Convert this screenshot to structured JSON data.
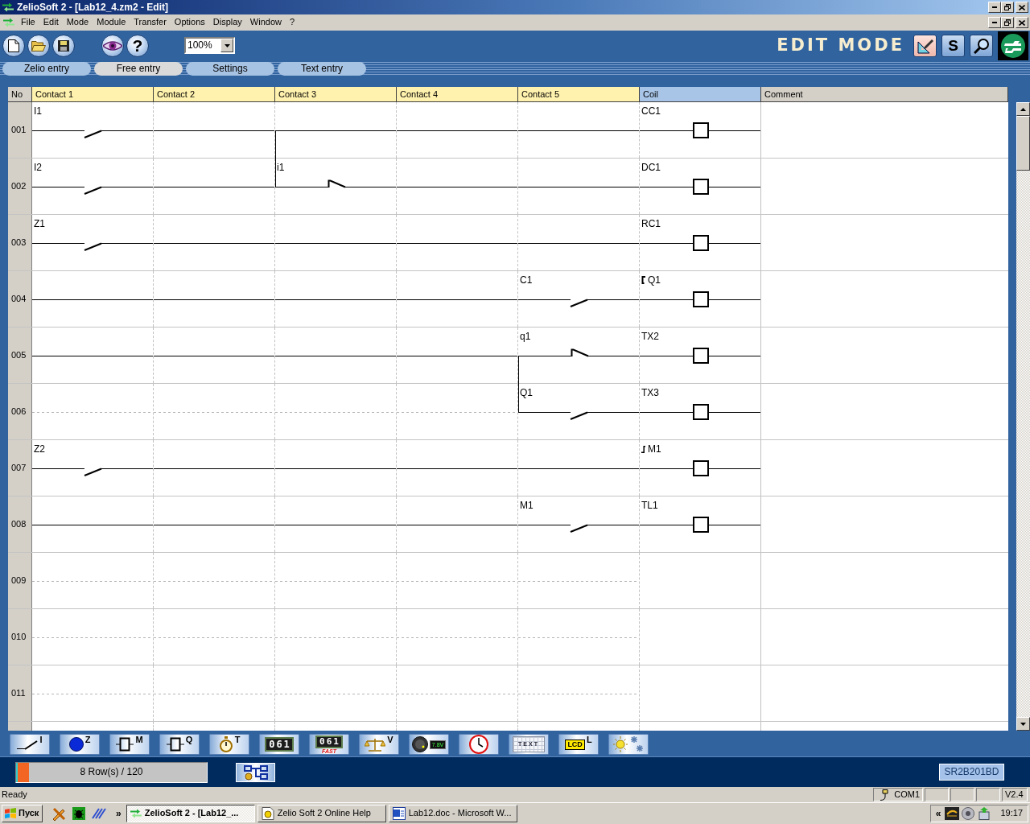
{
  "window": {
    "title": "ZelioSoft 2 - [Lab12_4.zm2 - Edit]"
  },
  "menu": [
    "File",
    "Edit",
    "Mode",
    "Module",
    "Transfer",
    "Options",
    "Display",
    "Window",
    "?"
  ],
  "toolbar": {
    "buttons": [
      {
        "kind": "new"
      },
      {
        "kind": "open"
      },
      {
        "kind": "save"
      },
      {
        "kind": "view"
      },
      {
        "kind": "help",
        "text": "?"
      }
    ],
    "zoom": "100%",
    "mode_label": "EDIT MODE",
    "mode_buttons": [
      {
        "kind": "edit",
        "selected": true
      },
      {
        "kind": "simulation",
        "text": "S",
        "selected": false
      },
      {
        "kind": "monitoring",
        "selected": false
      }
    ]
  },
  "tabs": [
    {
      "label": "Zelio entry",
      "selected": false
    },
    {
      "label": "Free entry",
      "selected": true
    },
    {
      "label": "Settings",
      "selected": false
    },
    {
      "label": "Text entry",
      "selected": false
    }
  ],
  "ladder": {
    "columns": [
      {
        "label": "No",
        "kind": "number"
      },
      {
        "label": "Contact 1",
        "kind": "contact"
      },
      {
        "label": "Contact 2",
        "kind": "contact"
      },
      {
        "label": "Contact 3",
        "kind": "contact"
      },
      {
        "label": "Contact 4",
        "kind": "contact"
      },
      {
        "label": "Contact 5",
        "kind": "contact"
      },
      {
        "label": "Coil",
        "kind": "coil"
      },
      {
        "label": "Comment",
        "kind": "comment"
      }
    ],
    "rows": [
      {
        "number": "001",
        "contacts": [
          {
            "kind": "no_contact",
            "label": "I1",
            "branch_down": false
          },
          {
            "kind": "wire",
            "branch_down": false
          },
          {
            "kind": "wire",
            "branch_down": true
          },
          {
            "kind": "wire",
            "branch_down": false
          },
          {
            "kind": "wire",
            "branch_down": false
          }
        ],
        "coil": {
          "label": "CC1",
          "kind": "plain"
        }
      },
      {
        "number": "002",
        "contacts": [
          {
            "kind": "no_contact",
            "label": "I2",
            "branch_down": false
          },
          {
            "kind": "wire",
            "branch_down": false
          },
          {
            "kind": "nc_contact",
            "label": "i1",
            "branch_down": false
          },
          {
            "kind": "wire",
            "branch_down": false
          },
          {
            "kind": "wire",
            "branch_down": false
          }
        ],
        "coil": {
          "label": "DC1",
          "kind": "plain"
        }
      },
      {
        "number": "003",
        "contacts": [
          {
            "kind": "no_contact",
            "label": "Z1",
            "branch_down": false
          },
          {
            "kind": "wire",
            "branch_down": false
          },
          {
            "kind": "wire",
            "branch_down": false
          },
          {
            "kind": "wire",
            "branch_down": false
          },
          {
            "kind": "wire",
            "branch_down": false
          }
        ],
        "coil": {
          "label": "RC1",
          "kind": "plain"
        }
      },
      {
        "number": "004",
        "contacts": [
          {
            "kind": "wire",
            "branch_down": false
          },
          {
            "kind": "wire",
            "branch_down": false
          },
          {
            "kind": "wire",
            "branch_down": false
          },
          {
            "kind": "wire",
            "branch_down": false
          },
          {
            "kind": "no_contact",
            "label": "C1",
            "branch_down": false
          }
        ],
        "coil": {
          "label": "Q1",
          "kind": "contactor"
        }
      },
      {
        "number": "005",
        "contacts": [
          {
            "kind": "wire",
            "branch_down": false
          },
          {
            "kind": "wire",
            "branch_down": false
          },
          {
            "kind": "wire",
            "branch_down": false
          },
          {
            "kind": "wire",
            "branch_down": false
          },
          {
            "kind": "nc_contact",
            "label": "q1",
            "branch_down": true
          }
        ],
        "coil": {
          "label": "TX2",
          "kind": "plain"
        }
      },
      {
        "number": "006",
        "contacts": [
          {
            "kind": "empty",
            "branch_down": false
          },
          {
            "kind": "empty",
            "branch_down": false
          },
          {
            "kind": "empty",
            "branch_down": false
          },
          {
            "kind": "empty",
            "branch_down": false
          },
          {
            "kind": "no_contact",
            "label": "Q1",
            "branch_down": false
          }
        ],
        "coil": {
          "label": "TX3",
          "kind": "plain"
        }
      },
      {
        "number": "007",
        "contacts": [
          {
            "kind": "no_contact",
            "label": "Z2",
            "branch_down": false
          },
          {
            "kind": "wire",
            "branch_down": false
          },
          {
            "kind": "wire",
            "branch_down": false
          },
          {
            "kind": "wire",
            "branch_down": false
          },
          {
            "kind": "wire",
            "branch_down": false
          }
        ],
        "coil": {
          "label": "M1",
          "kind": "impulse"
        }
      },
      {
        "number": "008",
        "contacts": [
          {
            "kind": "wire",
            "branch_down": false
          },
          {
            "kind": "wire",
            "branch_down": false
          },
          {
            "kind": "wire",
            "branch_down": false
          },
          {
            "kind": "wire",
            "branch_down": false
          },
          {
            "kind": "no_contact",
            "label": "M1",
            "branch_down": false
          }
        ],
        "coil": {
          "label": "TL1",
          "kind": "plain"
        }
      },
      {
        "number": "009",
        "contacts": [
          {
            "kind": "empty",
            "branch_down": false
          },
          {
            "kind": "empty",
            "branch_down": false
          },
          {
            "kind": "empty",
            "branch_down": false
          },
          {
            "kind": "empty",
            "branch_down": false
          },
          {
            "kind": "empty",
            "branch_down": false
          }
        ]
      },
      {
        "number": "010",
        "contacts": [
          {
            "kind": "empty",
            "branch_down": false
          },
          {
            "kind": "empty",
            "branch_down": false
          },
          {
            "kind": "empty",
            "branch_down": false
          },
          {
            "kind": "empty",
            "branch_down": false
          },
          {
            "kind": "empty",
            "branch_down": false
          }
        ]
      },
      {
        "number": "011",
        "contacts": [
          {
            "kind": "empty",
            "branch_down": false
          },
          {
            "kind": "empty",
            "branch_down": false
          },
          {
            "kind": "empty",
            "branch_down": false
          },
          {
            "kind": "empty",
            "branch_down": false
          },
          {
            "kind": "empty",
            "branch_down": false
          }
        ]
      }
    ]
  },
  "function_buttons": [
    {
      "kind": "inputs",
      "letter": "I"
    },
    {
      "kind": "keys",
      "letter": "Z"
    },
    {
      "kind": "relays",
      "letter": "M"
    },
    {
      "kind": "outputs",
      "letter": "Q"
    },
    {
      "kind": "timers",
      "letter": "T"
    },
    {
      "kind": "counters",
      "display": "061"
    },
    {
      "kind": "fast_counters",
      "display": "061",
      "caption": "FAST"
    },
    {
      "kind": "comparators",
      "letter": "V"
    },
    {
      "kind": "analog",
      "display": "7.8V"
    },
    {
      "kind": "clocks"
    },
    {
      "kind": "texts",
      "display": "TEXT"
    },
    {
      "kind": "backlight",
      "display": "LCD",
      "letter": "L"
    },
    {
      "kind": "summer_winter"
    }
  ],
  "status": {
    "rows_meter": {
      "text": "8 Row(s) / 120",
      "level": 0.067
    },
    "module": "SR2B201BD"
  },
  "status_bar": {
    "text": "Ready",
    "panels": [
      {
        "kind": "port",
        "text": "COM1"
      },
      {
        "kind": "blank"
      },
      {
        "kind": "blank"
      },
      {
        "kind": "blank"
      },
      {
        "kind": "text",
        "text": "V2.4"
      }
    ]
  },
  "taskbar": {
    "start": "Пуск",
    "quick_launch": [
      {
        "kind": "tools"
      },
      {
        "kind": "beetle"
      },
      {
        "kind": "stripes"
      }
    ],
    "more": "»",
    "tasks": [
      {
        "kind": "zelio",
        "label": "ZelioSoft 2 - [Lab12_...",
        "selected": true
      },
      {
        "kind": "help",
        "label": "Zelio Soft 2 Online Help",
        "selected": false
      },
      {
        "kind": "document",
        "label": "Lab12.doc - Microsoft W...",
        "selected": false
      }
    ],
    "tray": {
      "expand": "«",
      "icons": [
        {
          "kind": "display"
        },
        {
          "kind": "speaker"
        },
        {
          "kind": "network"
        }
      ],
      "clock": "19:17"
    }
  }
}
